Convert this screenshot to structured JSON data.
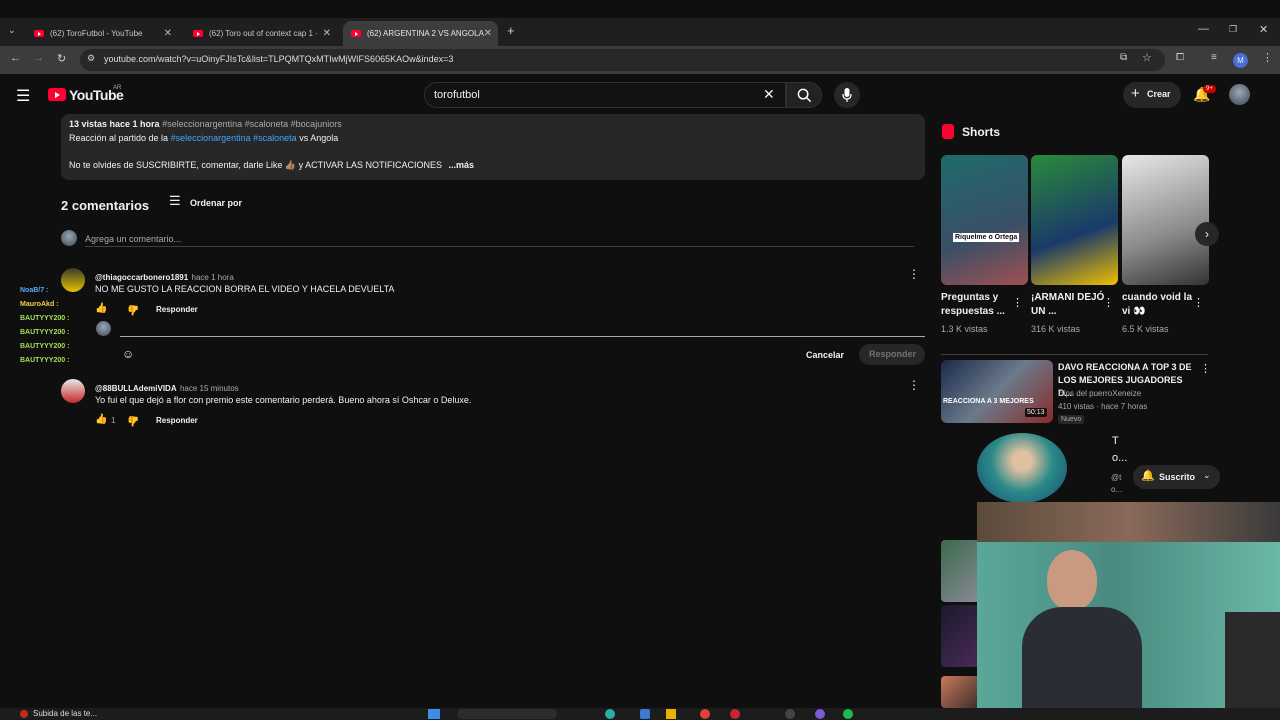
{
  "browser": {
    "tabs": [
      {
        "label": "(62) ToroFutbol - YouTube",
        "active": false
      },
      {
        "label": "(62) Toro out of context cap 1 ·",
        "active": false
      },
      {
        "label": "(62) ARGENTINA 2 VS ANGOLA",
        "active": true
      }
    ],
    "url": "youtube.com/watch?v=uOinyFJIsTc&list=TLPQMTQxMTIwMjWIFS6065KAOw&index=3",
    "profile_initial": "M"
  },
  "header": {
    "logo_text": "YouTube",
    "region": "AR",
    "search_value": "torofutbol",
    "create_label": "Crear",
    "notif_badge": "9+"
  },
  "description": {
    "stats": "13 vistas  hace 1 hora",
    "tags": "#seleccionargentina #scaloneta #bocajuniors",
    "line2_prefix": "Reacción al partido de la",
    "line2_tag1": "#seleccionargentina",
    "line2_tag2": "#scaloneta",
    "line2_suffix": "vs Angola",
    "line3": "No te olvides de SUSCRIBIRTE, comentar, darle Like 👍🏽 y ACTIVAR LAS NOTIFICACIONES",
    "more": "...más"
  },
  "comments": {
    "count_label": "2 comentarios",
    "sort_label": "Ordenar por",
    "add_placeholder": "Agrega un comentario...",
    "items": [
      {
        "author": "@thiagoccarbonero1891",
        "time": "hace 1 hora",
        "text": "NO ME GUSTO LA REACCION BORRA EL VIDEO Y HACELA DEVUELTA",
        "likes": "",
        "reply": "Responder"
      },
      {
        "author": "@88BULLAdemiVIDA",
        "time": "hace 15 minutos",
        "text": "Yo fui el que dejó a flor con premio este comentario perderá. Bueno ahora sí Oshcar o Deluxe.",
        "likes": "1",
        "reply": "Responder"
      }
    ],
    "reply_box": {
      "cancel": "Cancelar",
      "submit": "Responder"
    }
  },
  "chat_overlay": [
    {
      "name": "NoaB/7 :",
      "color": "#5aa8ff"
    },
    {
      "name": "MauroAkd :",
      "color": "#f5d142"
    },
    {
      "name": "BAUTYYY200 :",
      "color": "#9fe45a"
    },
    {
      "name": "BAUTYYY200 :",
      "color": "#9fe45a"
    },
    {
      "name": "BAUTYYY200 :",
      "color": "#9fe45a"
    },
    {
      "name": "BAUTYYY200 :",
      "color": "#9fe45a"
    }
  ],
  "sidebar": {
    "shorts_title": "Shorts",
    "shorts": [
      {
        "title": "Preguntas y respuestas ...",
        "views": "1.3 K vistas",
        "thumb_text": "Riquelme o Ortega"
      },
      {
        "title": "¡ARMANI DEJÓ UN ...",
        "views": "316 K vistas",
        "thumb_text": ""
      },
      {
        "title": "cuando void la vi 👀",
        "views": "6.5 K vistas",
        "thumb_text": ""
      }
    ],
    "video": {
      "title": "DAVO REACCIONA A TOP 3 DE LOS MEJORES JUGADORES D...",
      "channel": "clips del puerroXeneize",
      "meta": "410 vistas · hace 7 horas",
      "badge": "Nuevo",
      "duration": "50:13",
      "thumb_text": "REACCIONA A 3 MEJORES"
    },
    "channel_card": {
      "line1": "T",
      "line2": "o...",
      "line3": "@t",
      "line4": "o...",
      "subscribed": "Suscrito"
    }
  },
  "taskbar": {
    "notification": "Subida de las te..."
  }
}
